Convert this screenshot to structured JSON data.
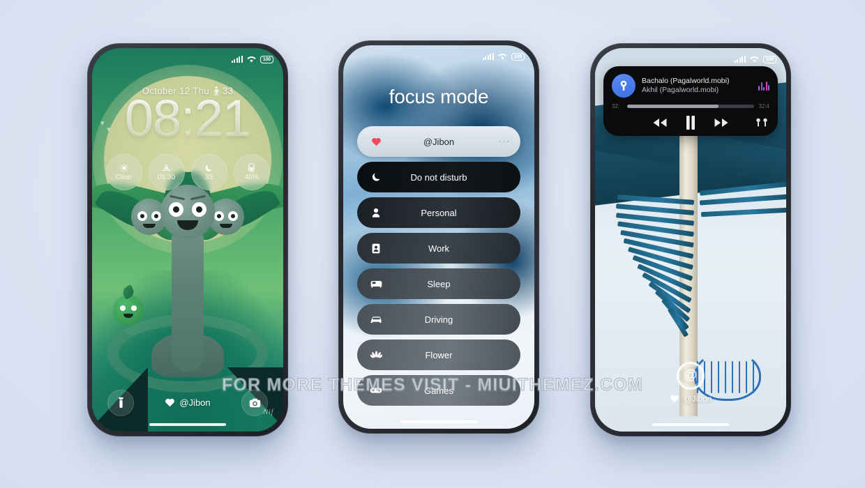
{
  "background_color": "#dee6f4",
  "watermark": "FOR MORE THEMES VISIT - MIUITHEMEZ.COM",
  "phone1": {
    "status": {
      "battery": "100",
      "signal_icon": "signal-bars-icon",
      "wifi_icon": "wifi-icon"
    },
    "date": "October 12 Thu",
    "steps": "33",
    "steps_icon": "walking-icon",
    "time": "08:21",
    "widgets": [
      {
        "icon": "sun-icon",
        "glyph": "☀",
        "label": "Clear",
        "name": "weather-widget"
      },
      {
        "icon": "sunrise-icon",
        "glyph": "⛰",
        "label": "05:30",
        "name": "sunrise-widget"
      },
      {
        "icon": "moon-icon",
        "glyph": "☾",
        "label": "33",
        "name": "moon-widget"
      },
      {
        "icon": "battery-icon",
        "glyph": "❙",
        "label": "40%",
        "name": "battery-widget"
      }
    ],
    "left_shortcut": "flashlight-icon",
    "right_shortcut": "camera-icon",
    "signature": "@Jibon",
    "signature_icon": "heart-icon",
    "artist_mark": "Nif"
  },
  "phone2": {
    "status": {
      "battery": "100",
      "signal_icon": "signal-bars-icon",
      "wifi_icon": "wifi-icon"
    },
    "title": "focus mode",
    "items": [
      {
        "label": "@Jibon",
        "icon": "heart-icon",
        "selected": true,
        "more": "···"
      },
      {
        "label": "Do not disturb",
        "icon": "moon-icon",
        "selected": false
      },
      {
        "label": "Personal",
        "icon": "person-icon",
        "selected": false
      },
      {
        "label": "Work",
        "icon": "badge-icon",
        "selected": false
      },
      {
        "label": "Sleep",
        "icon": "bed-icon",
        "selected": false
      },
      {
        "label": "Driving",
        "icon": "car-icon",
        "selected": false
      },
      {
        "label": "Flower",
        "icon": "flower-icon",
        "selected": false
      },
      {
        "label": "Games",
        "icon": "gamepad-icon",
        "selected": false
      }
    ]
  },
  "phone3": {
    "status": {
      "battery": "100",
      "signal_icon": "signal-bars-icon",
      "wifi_icon": "wifi-icon"
    },
    "player": {
      "title": "Bachalo (Pagalworld.mobi)",
      "artist": "Akhil (Pagalworld.mobi)",
      "album_art_icon": "music-app-icon",
      "visualizer_icon": "equalizer-icon",
      "elapsed": "32:",
      "remaining": "32:4",
      "progress_percent": 72,
      "prev_icon": "rewind-icon",
      "play_pause_icon": "pause-icon",
      "next_icon": "fast-forward-icon",
      "output_icon": "earbuds-icon"
    },
    "logo_glyph": "@",
    "signature": "@Jibon",
    "signature_icon": "heart-icon"
  }
}
